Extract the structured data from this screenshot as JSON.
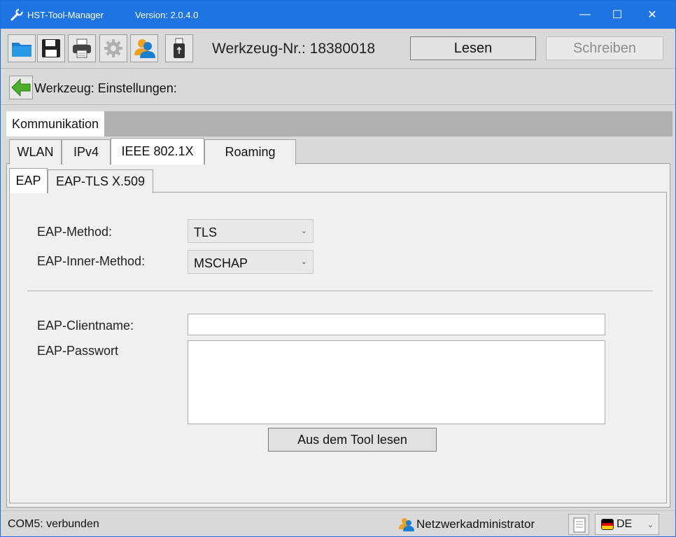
{
  "window": {
    "title": "HST-Tool-Manager",
    "version": "Version: 2.0.4.0",
    "controls": {
      "minimize": "—",
      "maximize": "☐",
      "close": "✕"
    }
  },
  "toolbar": {
    "icons": [
      "folder-open-icon",
      "save-disk-icon",
      "printer-icon",
      "gear-icon",
      "users-icon",
      "usb-stick-icon"
    ],
    "tool_number": "Werkzeug-Nr.: 18380018",
    "read_button": "Lesen",
    "write_button": "Schreiben"
  },
  "breadcrumb": {
    "title": "Werkzeug: Einstellungen:"
  },
  "main_tabs": [
    {
      "label": "Kommunikation",
      "active": true
    }
  ],
  "sub_tabs": [
    {
      "label": "WLAN",
      "active": false
    },
    {
      "label": "IPv4",
      "active": false
    },
    {
      "label": "IEEE 802.1X",
      "active": true
    },
    {
      "label": "Roaming",
      "active": false
    }
  ],
  "inner_tabs": [
    {
      "label": "EAP",
      "active": true
    },
    {
      "label": "EAP-TLS X.509",
      "active": false
    }
  ],
  "form": {
    "eap_method_label": "EAP-Method:",
    "eap_method_value": "TLS",
    "eap_inner_method_label": "EAP-Inner-Method:",
    "eap_inner_method_value": "MSCHAP",
    "client_name_label": "EAP-Clientname:",
    "client_name_value": "",
    "password_label": "EAP-Passwort",
    "password_value": "",
    "read_from_tool_button": "Aus dem Tool lesen"
  },
  "status": {
    "connection": "COM5: verbunden",
    "user": "Netzwerkadministrator",
    "language": "DE"
  },
  "colors": {
    "titlebar": "#1e74e0",
    "accent_green": "#4caf2c",
    "flag": [
      "#000000",
      "#dd0000",
      "#ffce00"
    ]
  }
}
